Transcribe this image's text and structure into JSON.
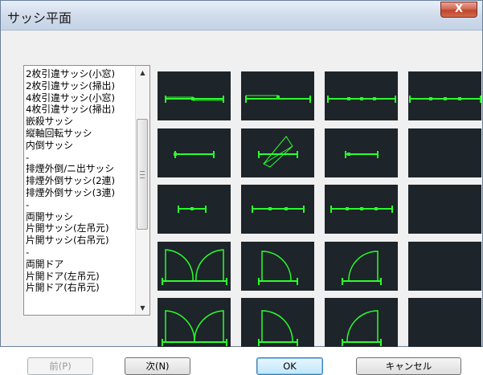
{
  "window": {
    "title": "サッシ平面",
    "close_label": "X"
  },
  "list": {
    "items": [
      "2枚引違サッシ(小窓)",
      "2枚引違サッシ(掃出)",
      "4枚引違サッシ(小窓)",
      "4枚引違サッシ(掃出)",
      "嵌殺サッシ",
      "縦軸回転サッシ",
      "内倒サッシ",
      "-",
      "排煙外倒/ニ出サッシ",
      "排煙外倒サッシ(2連)",
      "排煙外倒サッシ(3連)",
      "-",
      "両開サッシ",
      "片開サッシ(左吊元)",
      "片開サッシ(右吊元)",
      "-",
      "両開ドア",
      "片開ドア(左吊元)",
      "片開ドア(右吊元)"
    ]
  },
  "scrollbar": {
    "up_icon": "triangle-up",
    "down_icon": "triangle-down",
    "grip_icon": "scroll-grip"
  },
  "tiles": [
    {
      "name": "sash-2-sliding-small",
      "icon": "plan-sliding-2"
    },
    {
      "name": "sash-2-sliding-floor",
      "icon": "plan-sliding-2-wide"
    },
    {
      "name": "sash-4-sliding-small",
      "icon": "plan-sliding-4"
    },
    {
      "name": "sash-4-sliding-floor",
      "icon": "plan-sliding-4-wide"
    },
    {
      "name": "fixed-sash",
      "icon": "plan-fixed"
    },
    {
      "name": "pivot-sash",
      "icon": "plan-pivot"
    },
    {
      "name": "inward-tilt-sash",
      "icon": "plan-tilt"
    },
    {
      "name": "empty-slot-1",
      "icon": "none"
    },
    {
      "name": "smoke-vent-sash",
      "icon": "plan-vent-1"
    },
    {
      "name": "smoke-vent-sash-2",
      "icon": "plan-vent-2"
    },
    {
      "name": "smoke-vent-sash-3",
      "icon": "plan-vent-3"
    },
    {
      "name": "empty-slot-2",
      "icon": "none"
    },
    {
      "name": "double-casement-sash",
      "icon": "plan-double-swing"
    },
    {
      "name": "casement-sash-left",
      "icon": "plan-swing-left"
    },
    {
      "name": "casement-sash-right",
      "icon": "plan-swing-right"
    },
    {
      "name": "empty-slot-3",
      "icon": "none"
    },
    {
      "name": "double-door",
      "icon": "plan-double-door"
    },
    {
      "name": "single-door-left",
      "icon": "plan-door-left"
    },
    {
      "name": "single-door-right",
      "icon": "plan-door-right"
    },
    {
      "name": "empty-slot-4",
      "icon": "none"
    }
  ],
  "colors": {
    "tile_bg": "#1d242a",
    "symbol": "#2bff2b",
    "accent": "#3c7fb1"
  },
  "buttons": {
    "prev": "前(P)",
    "next": "次(N)",
    "ok": "OK",
    "cancel": "キャンセル"
  }
}
